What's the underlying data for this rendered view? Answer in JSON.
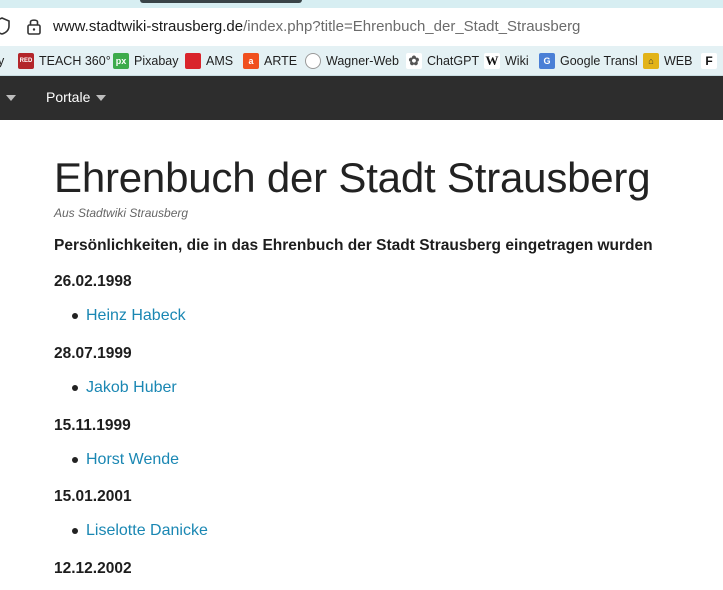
{
  "browser": {
    "url_domain": "www.stadtwiki-strausberg.de",
    "url_path": "/index.php?title=Ehrenbuch_der_Stadt_Strausberg"
  },
  "bookmarks": [
    {
      "label": "y",
      "icon": ""
    },
    {
      "label": "TEACH 360°",
      "icon": "RED",
      "color": "#b3262b"
    },
    {
      "label": "Pixabay",
      "icon": "px",
      "color": "#3dab4c"
    },
    {
      "label": "AMS",
      "icon": "",
      "color": "#d9242b"
    },
    {
      "label": "ARTE",
      "icon": "a",
      "color": "#f0501e"
    },
    {
      "label": "Wagner-Web",
      "icon": "",
      "color": "#9a9a9a"
    },
    {
      "label": "ChatGPT",
      "icon": "",
      "color": "#7a7a7a"
    },
    {
      "label": "Wiki",
      "icon": "W",
      "color": "#ffffff"
    },
    {
      "label": "Google Transl",
      "icon": "G",
      "color": "#4a7fd6"
    },
    {
      "label": "WEB",
      "icon": "",
      "color": "#e2b318"
    },
    {
      "label": "F",
      "icon": "F",
      "color": "#ffffff"
    }
  ],
  "navbar": {
    "portale": "Portale"
  },
  "page": {
    "title": "Ehrenbuch der Stadt Strausberg",
    "subtitle": "Aus Stadtwiki Strausberg",
    "lead": "Persönlichkeiten, die in das Ehrenbuch der Stadt Strausberg eingetragen wurden",
    "entries": [
      {
        "date": "26.02.1998",
        "name": "Heinz Habeck"
      },
      {
        "date": "28.07.1999",
        "name": "Jakob Huber"
      },
      {
        "date": "15.11.1999",
        "name": "Horst Wende"
      },
      {
        "date": "15.01.2001",
        "name": "Liselotte Danicke"
      },
      {
        "date": "12.12.2002",
        "name": ""
      }
    ]
  }
}
